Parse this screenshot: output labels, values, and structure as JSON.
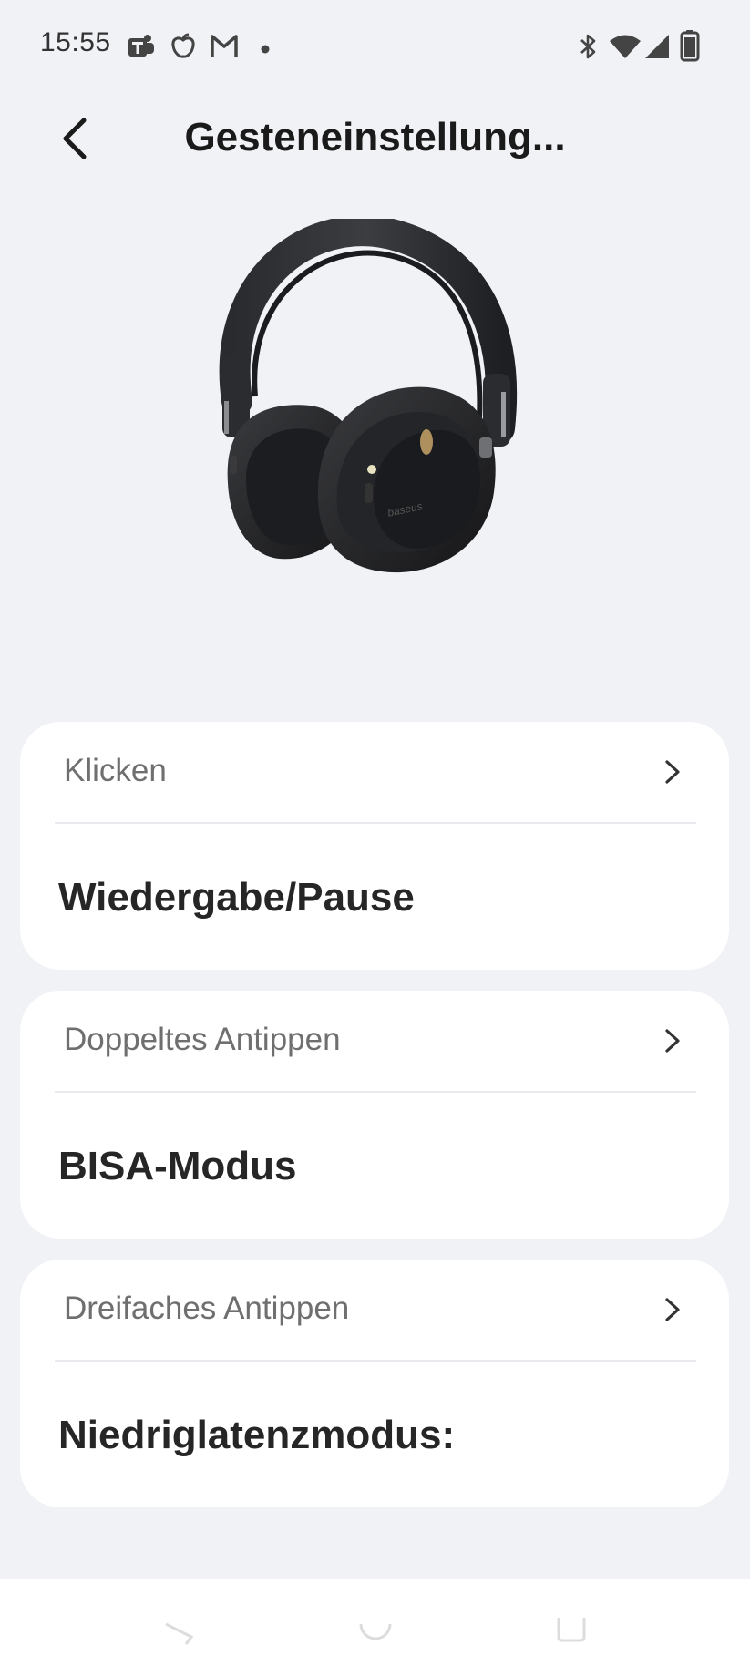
{
  "status_bar": {
    "time": "15:55",
    "notification_icons": [
      "teams-icon",
      "health-app-icon",
      "gmail-icon",
      "dot-icon"
    ],
    "system_icons": [
      "bluetooth-icon",
      "wifi-icon",
      "cell-signal-icon",
      "battery-icon"
    ]
  },
  "header": {
    "back_icon": "chevron-left-icon",
    "title": "Gesteneinstellung..."
  },
  "product": {
    "image": "headphones-image",
    "brand_print": "baseus"
  },
  "gestures": [
    {
      "label": "Klicken",
      "value": "Wiedergabe/Pause"
    },
    {
      "label": "Doppeltes Antippen",
      "value": "BISA-Modus"
    },
    {
      "label": "Dreifaches Antippen",
      "value": "Niedriglatenzmodus:"
    }
  ],
  "nav_bar": {
    "buttons": [
      "back-nav-icon",
      "home-nav-icon",
      "recents-nav-icon"
    ]
  },
  "colors": {
    "background": "#f1f2f6",
    "card": "#ffffff",
    "label_gray": "#6f6f6f",
    "value_dark": "#262626"
  }
}
